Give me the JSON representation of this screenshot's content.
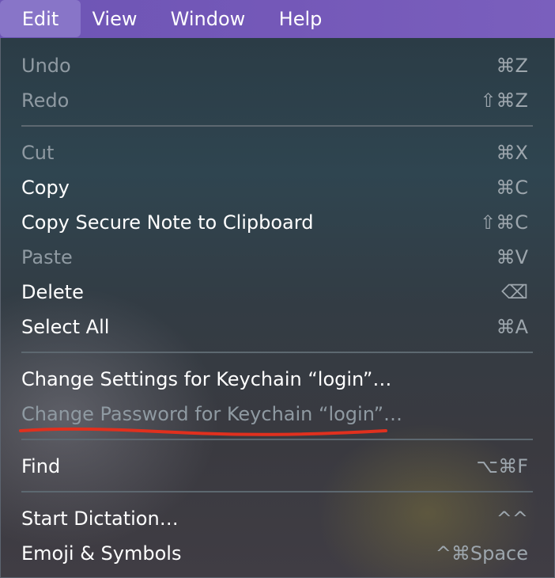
{
  "menubar": {
    "items": [
      {
        "label": "Edit"
      },
      {
        "label": "View"
      },
      {
        "label": "Window"
      },
      {
        "label": "Help"
      }
    ]
  },
  "menu": {
    "items": [
      {
        "label": "Undo",
        "shortcut": "⌘Z"
      },
      {
        "label": "Redo",
        "shortcut": "⇧⌘Z"
      },
      {
        "label": "Cut",
        "shortcut": "⌘X"
      },
      {
        "label": "Copy",
        "shortcut": "⌘C"
      },
      {
        "label": "Copy Secure Note to Clipboard",
        "shortcut": "⇧⌘C"
      },
      {
        "label": "Paste",
        "shortcut": "⌘V"
      },
      {
        "label": "Delete",
        "shortcut": "⌫"
      },
      {
        "label": "Select All",
        "shortcut": "⌘A"
      },
      {
        "label": "Change Settings for Keychain “login”…",
        "shortcut": ""
      },
      {
        "label": "Change Password for Keychain “login”…",
        "shortcut": ""
      },
      {
        "label": "Find",
        "shortcut": "⌥⌘F"
      },
      {
        "label": "Start Dictation…",
        "shortcut": "^^"
      },
      {
        "label": "Emoji & Symbols",
        "shortcut": "^⌘Space"
      }
    ]
  },
  "annotation": {
    "color": "#e0301e"
  }
}
